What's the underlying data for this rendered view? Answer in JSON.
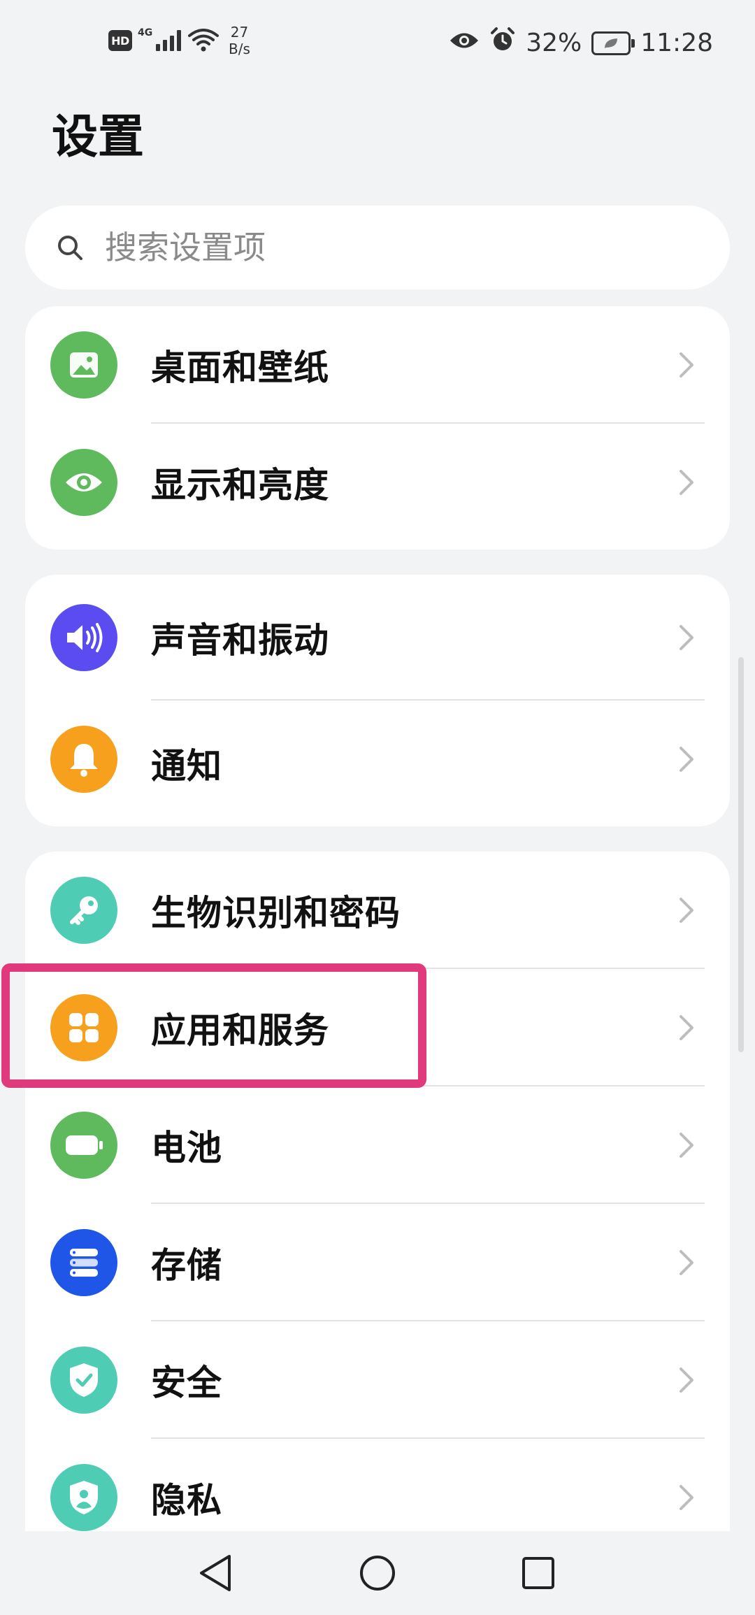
{
  "status_bar": {
    "hd_label": "HD",
    "network_label": "4G",
    "speed_value": "27",
    "speed_unit": "B/s",
    "battery_percent": "32%",
    "time": "11:28"
  },
  "page": {
    "title": "设置"
  },
  "search": {
    "placeholder": "搜索设置项"
  },
  "groups": [
    {
      "items": [
        {
          "label": "桌面和壁纸",
          "icon": "wallpaper-icon",
          "color": "#5fba5e"
        },
        {
          "label": "显示和亮度",
          "icon": "eye-icon",
          "color": "#5fba5e"
        }
      ]
    },
    {
      "items": [
        {
          "label": "声音和振动",
          "icon": "speaker-icon",
          "color": "#5a4cf0"
        },
        {
          "label": "通知",
          "icon": "bell-icon",
          "color": "#f7a01e"
        }
      ]
    },
    {
      "items": [
        {
          "label": "生物识别和密码",
          "icon": "key-icon",
          "color": "#4fccb4"
        },
        {
          "label": "应用和服务",
          "icon": "apps-grid-icon",
          "color": "#f7a01e"
        },
        {
          "label": "电池",
          "icon": "battery-icon",
          "color": "#5fba5e"
        },
        {
          "label": "存储",
          "icon": "storage-icon",
          "color": "#1f56e8"
        },
        {
          "label": "安全",
          "icon": "shield-check-icon",
          "color": "#4fccb4"
        },
        {
          "label": "隐私",
          "icon": "privacy-shield-icon",
          "color": "#4fccb4"
        }
      ]
    }
  ],
  "highlight_color": "#e03a7c"
}
